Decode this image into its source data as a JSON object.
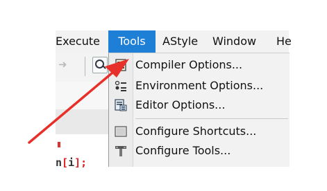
{
  "menubar": {
    "items": [
      {
        "label": "Execute"
      },
      {
        "label": "Tools"
      },
      {
        "label": "AStyle"
      },
      {
        "label": "Window"
      },
      {
        "label": "He"
      }
    ]
  },
  "code": {
    "prefix": "n",
    "red_bracket_open": "[",
    "var": "i",
    "red_bracket_close": "]",
    "suffix": ";"
  },
  "tools_menu": {
    "items": [
      {
        "label": "Compiler Options...",
        "icon": "compiler-options-icon"
      },
      {
        "label": "Environment Options...",
        "icon": "environment-options-icon"
      },
      {
        "label": "Editor Options...",
        "icon": "editor-options-icon"
      },
      {
        "label": "Configure Shortcuts...",
        "icon": "configure-shortcuts-icon"
      },
      {
        "label": "Configure Tools...",
        "icon": "configure-tools-icon"
      }
    ]
  },
  "colors": {
    "menu_highlight": "#1e7fd6",
    "annotation_arrow": "#e8302a"
  }
}
